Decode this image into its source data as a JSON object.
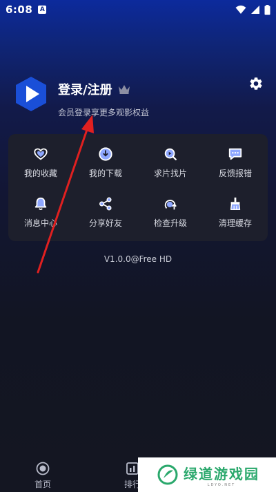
{
  "status_bar": {
    "time": "6:08",
    "notification_glyph": "A"
  },
  "profile": {
    "title": "登录/注册",
    "subtitle": "会员登录享更多观影权益"
  },
  "menu": [
    {
      "label": "我的收藏",
      "icon": "heart-icon"
    },
    {
      "label": "我的下载",
      "icon": "download-icon"
    },
    {
      "label": "求片找片",
      "icon": "search-film-icon"
    },
    {
      "label": "反馈报错",
      "icon": "feedback-icon"
    },
    {
      "label": "消息中心",
      "icon": "bell-icon"
    },
    {
      "label": "分享好友",
      "icon": "share-icon"
    },
    {
      "label": "检查升级",
      "icon": "upgrade-icon"
    },
    {
      "label": "清理缓存",
      "icon": "clean-icon"
    }
  ],
  "version": "V1.0.0@Free HD",
  "bottom_nav": [
    {
      "label": "首页",
      "icon": "home-icon"
    },
    {
      "label": "排行",
      "icon": "ranking-icon"
    }
  ],
  "watermark": {
    "name": "绿道游戏园",
    "domain": "LDYO.NET"
  },
  "colors": {
    "accent_blue": "#1a4fd8",
    "menu_icon": "#8ea7ff",
    "annotation_red": "#e02020",
    "watermark_green": "#2aa86c"
  }
}
